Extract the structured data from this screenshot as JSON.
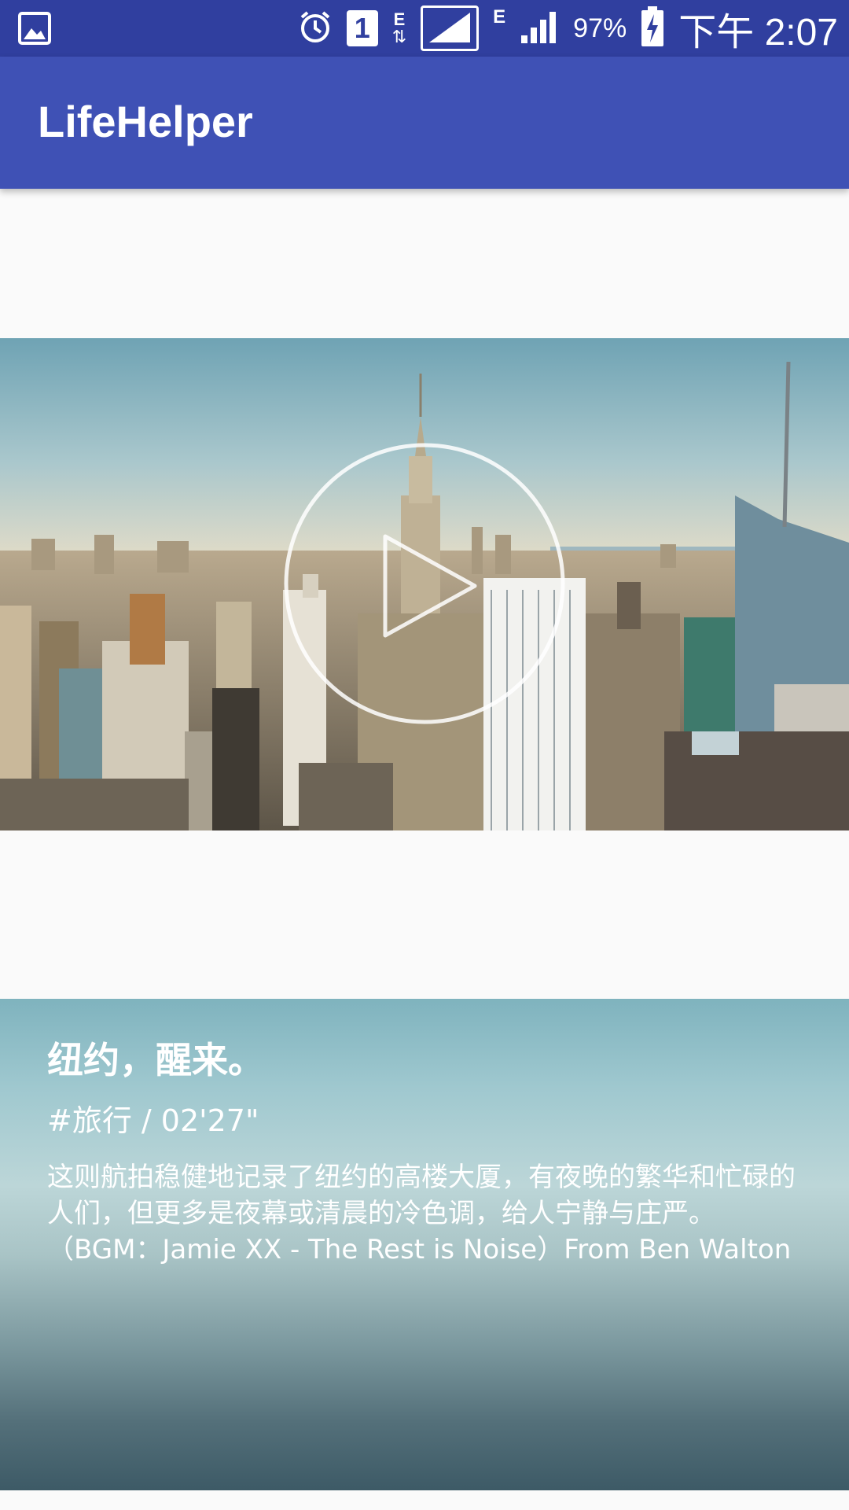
{
  "status_bar": {
    "icons": [
      "gallery-icon",
      "alarm-icon",
      "sim1-icon",
      "data-arrows-icon",
      "signal-icon",
      "network-e-icon",
      "signal-icon-2",
      "battery-charging-icon"
    ],
    "network_label_1": "E",
    "network_label_2": "E",
    "sim_label": "1",
    "battery": "97%",
    "time": "下午 2:07"
  },
  "app_bar": {
    "title": "LifeHelper"
  },
  "video": {
    "play_icon": "play-circle-icon"
  },
  "card": {
    "title": "纽约，醒来。",
    "tag": "#旅行 / 02'27\"",
    "description": "这则航拍稳健地记录了纽约的高楼大厦，有夜晚的繁华和忙碌的人们，但更多是夜幕或清晨的冷色调，给人宁静与庄严。（BGM：Jamie XX - The Rest is Noise）From Ben Walton"
  },
  "colors": {
    "status_bar": "#303f9f",
    "app_bar": "#3f51b5",
    "background": "#fafafa"
  }
}
